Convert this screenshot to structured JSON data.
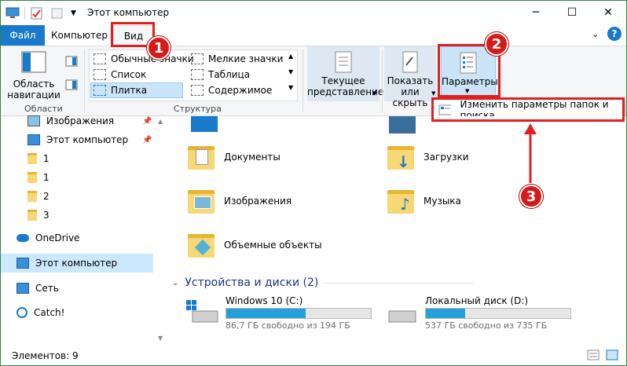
{
  "window": {
    "title": "Этот компьютер"
  },
  "tabs": [
    {
      "label": "Файл"
    },
    {
      "label": "Компьютер"
    },
    {
      "label": "Вид"
    }
  ],
  "ribbon": {
    "nav_pane_label": "Область\nнавигации",
    "group_areas": "Области",
    "layout_items": [
      "Обычные значки",
      "Мелкие значки",
      "Список",
      "Таблица",
      "Плитка",
      "Содержимое"
    ],
    "group_structure": "Структура",
    "current_view": "Текущее\nпредставление",
    "show_hide": "Показать\nили скрыть",
    "options": "Параметры",
    "dropdown_item": "Изменить параметры папок и поиска"
  },
  "nav": {
    "items": [
      "Изображения",
      "Этот компьютер",
      "1",
      "1",
      "2",
      "3",
      "OneDrive",
      "Этот компьютер",
      "Сеть",
      "Catch!"
    ]
  },
  "content": {
    "folders": [
      "Документы",
      "Загрузки",
      "Изображения",
      "Музыка",
      "Объемные объекты"
    ],
    "devices_header": "Устройства и диски (2)",
    "drives": [
      {
        "name": "Windows 10 (C:)",
        "free": "86,7 ГБ свободно из 194 ГБ",
        "used_fraction": 0.55
      },
      {
        "name": "Локальный диск (D:)",
        "free": "537 ГБ свободно из 735 ГБ",
        "used_fraction": 0.27
      }
    ]
  },
  "status": {
    "items": "Элементов: 9"
  },
  "annotations": [
    "1",
    "2",
    "3"
  ],
  "colors": {
    "accent": "#1979ca",
    "annotation": "#e02020",
    "bar": "#26a0da"
  }
}
